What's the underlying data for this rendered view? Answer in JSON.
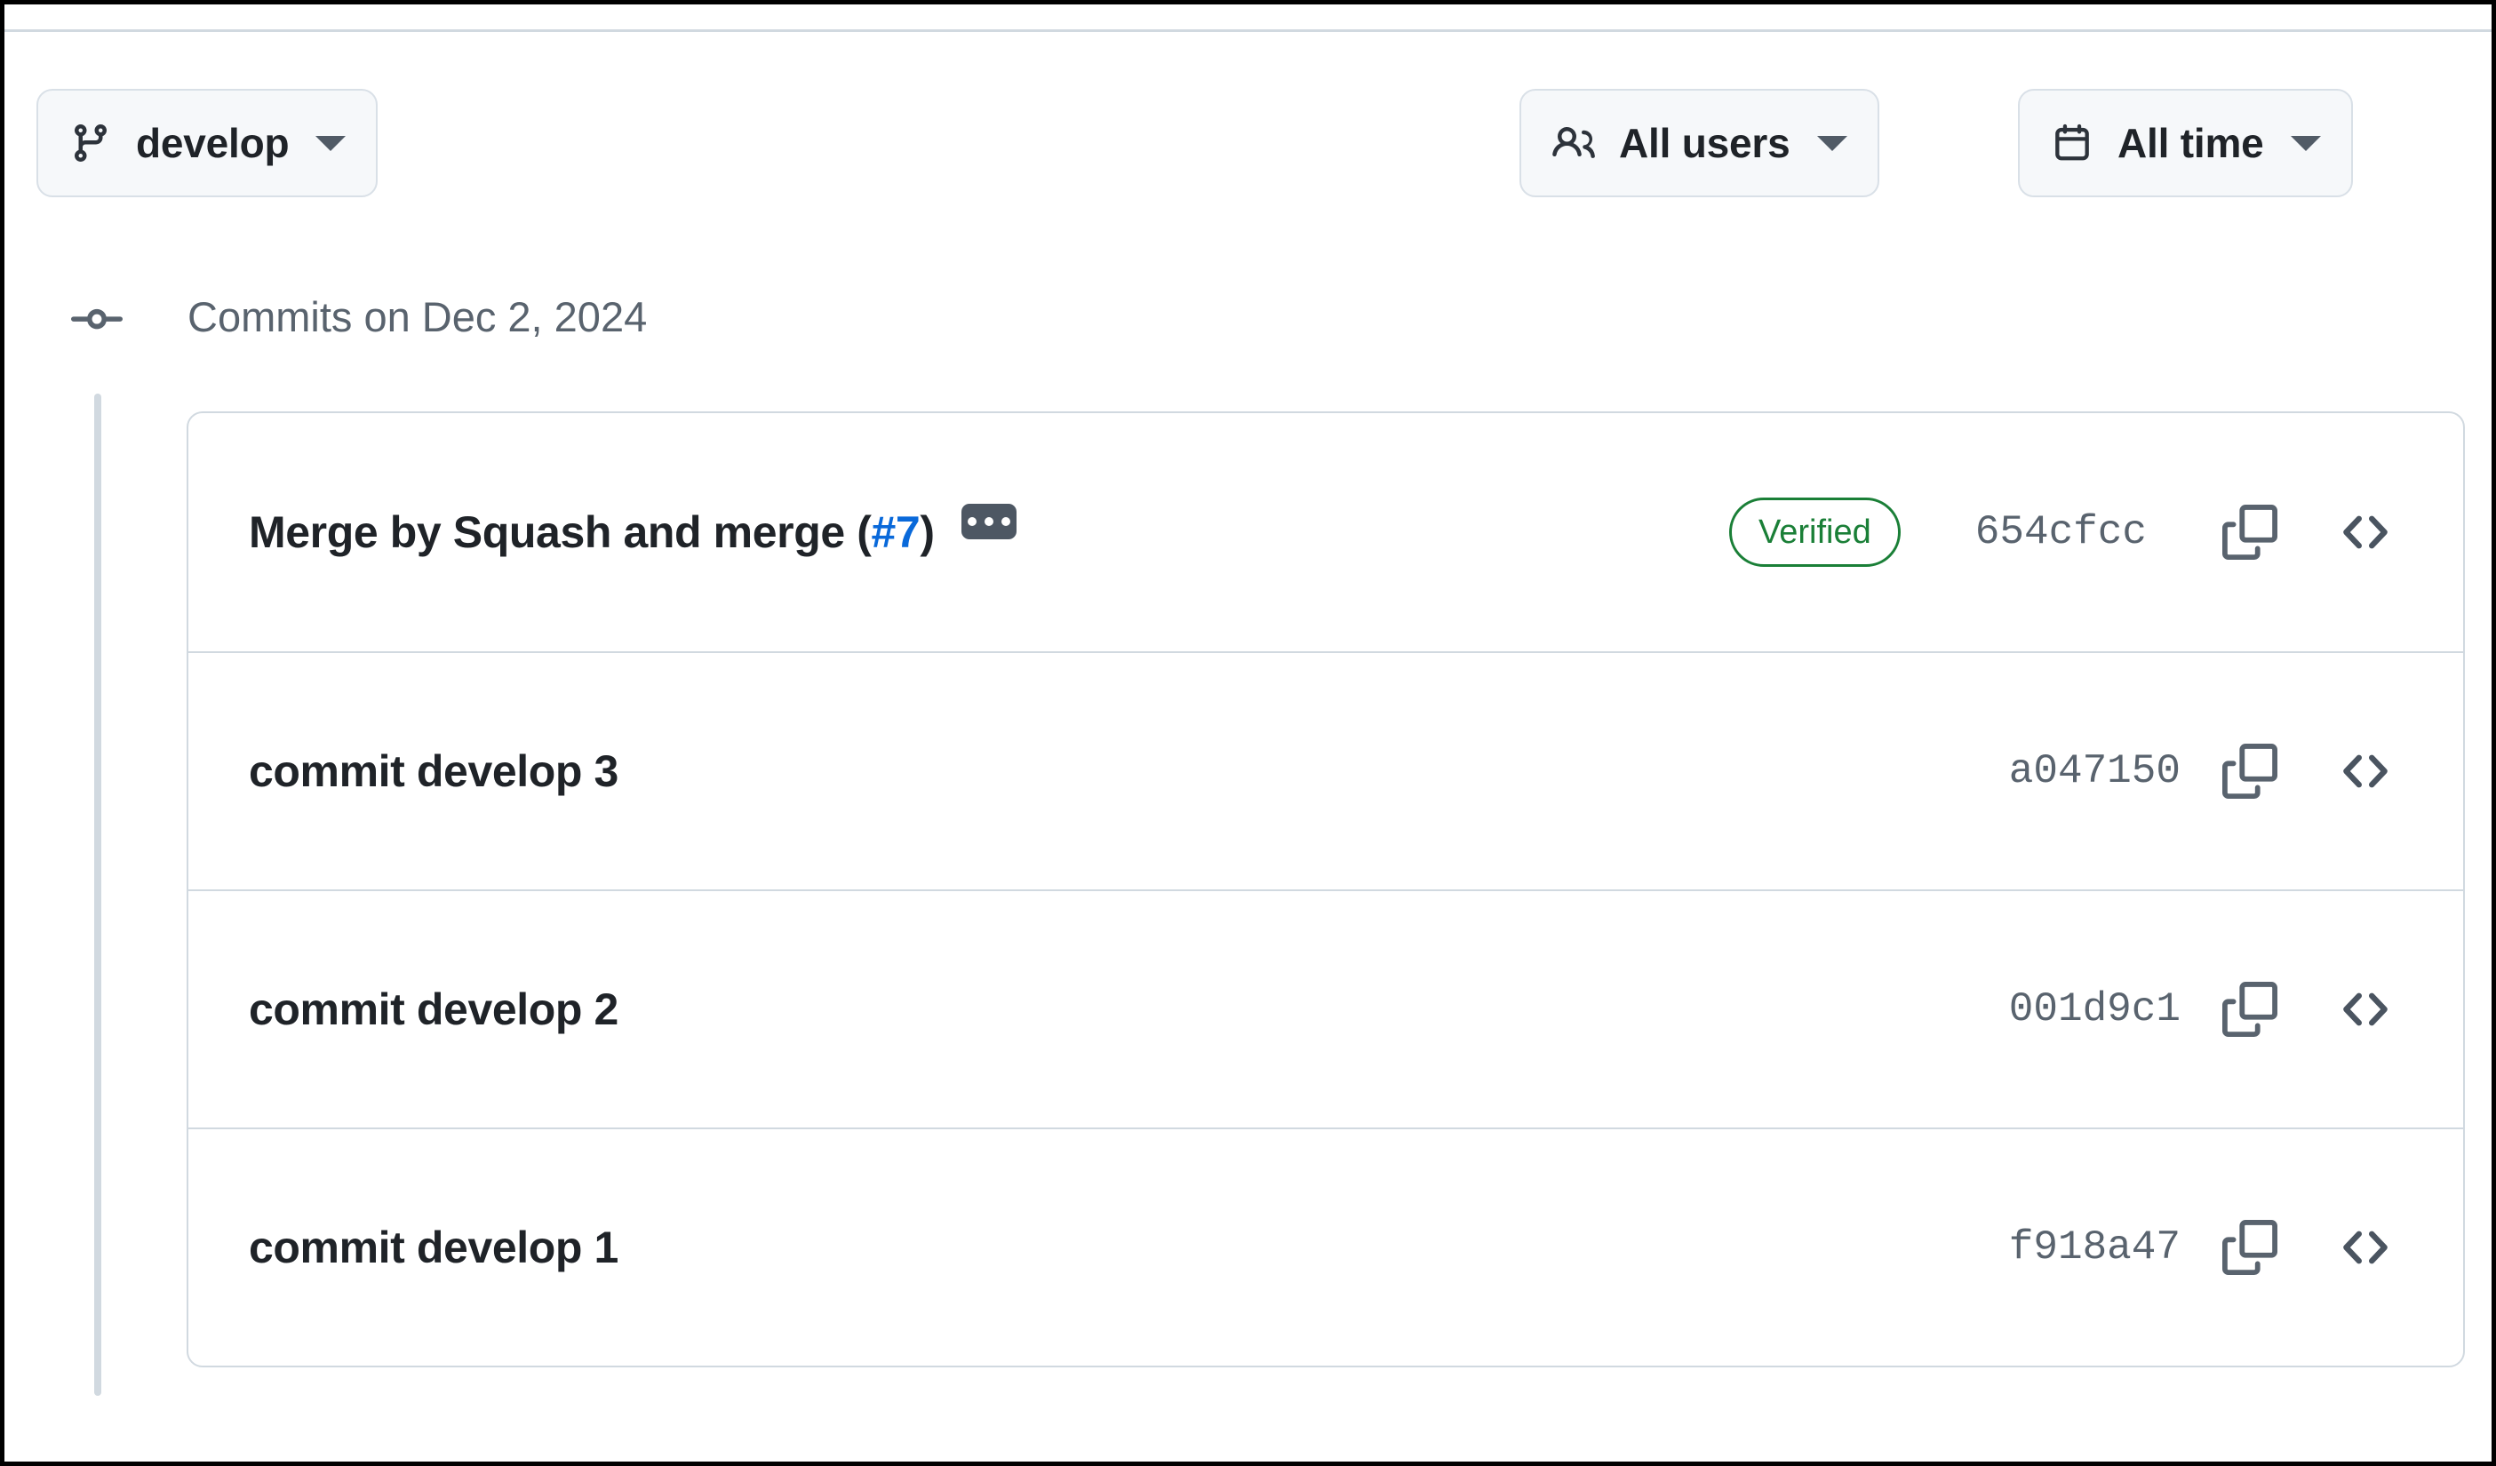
{
  "toolbar": {
    "branch_filter": {
      "label": "develop",
      "icon": "git-branch-icon",
      "caret": "chevron-down-icon"
    },
    "user_filter": {
      "label": "All users",
      "icon": "people-icon",
      "caret": "chevron-down-icon"
    },
    "time_filter": {
      "label": "All time",
      "icon": "calendar-icon",
      "caret": "chevron-down-icon"
    }
  },
  "commit_group": {
    "header": "Commits on Dec 2, 2024",
    "timeline_icon": "commit-dot-icon"
  },
  "commits": [
    {
      "title": "Merge by Squash and merge (",
      "pr_number": "#7",
      "title_suffix": ")",
      "has_pr_link": true,
      "expand_label": "...",
      "verified": "Verified",
      "sha": "654cfcc",
      "copy_icon": "copy-icon",
      "code_icon": "code-icon"
    },
    {
      "title": "commit develop 3",
      "pr_number": "",
      "title_suffix": "",
      "has_pr_link": false,
      "expand_label": "",
      "verified": "",
      "sha": "a047150",
      "copy_icon": "copy-icon",
      "code_icon": "code-icon"
    },
    {
      "title": "commit develop 2",
      "pr_number": "",
      "title_suffix": "",
      "has_pr_link": false,
      "expand_label": "",
      "verified": "",
      "sha": "001d9c1",
      "copy_icon": "copy-icon",
      "code_icon": "code-icon"
    },
    {
      "title": "commit develop 1",
      "pr_number": "",
      "title_suffix": "",
      "has_pr_link": false,
      "expand_label": "",
      "verified": "",
      "sha": "f918a47",
      "copy_icon": "copy-icon",
      "code_icon": "code-icon"
    }
  ],
  "colors": {
    "link": "#0969da",
    "verified_green": "#1a7f37",
    "muted_text": "#59636e",
    "border": "#d1d9e0",
    "button_bg": "#f6f8fa",
    "text": "#1f2328"
  }
}
